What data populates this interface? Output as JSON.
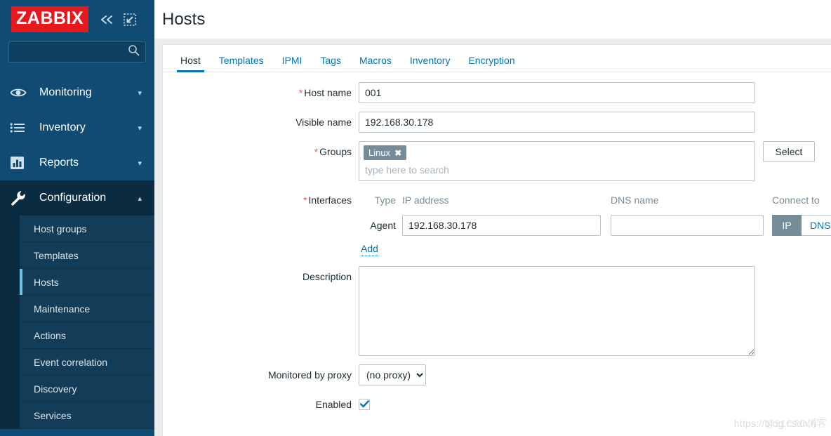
{
  "sidebar": {
    "logo_text": "ZABBIX",
    "logo_bg": "#e8191e",
    "background": "#0f4b72",
    "collapse_icon": "double-chevron-left-icon",
    "kiosk_icon": "kiosk-mode-icon",
    "search": {
      "value": "",
      "placeholder": "",
      "icon": "search-icon"
    },
    "nav": [
      {
        "label": "Monitoring",
        "icon": "eye-icon",
        "chevron": "chevron-down-icon",
        "expanded": false
      },
      {
        "label": "Inventory",
        "icon": "list-icon",
        "chevron": "chevron-down-icon",
        "expanded": false
      },
      {
        "label": "Reports",
        "icon": "bar-chart-icon",
        "chevron": "chevron-down-icon",
        "expanded": false
      },
      {
        "label": "Configuration",
        "icon": "wrench-icon",
        "chevron": "chevron-up-icon",
        "expanded": true
      }
    ],
    "submenu": [
      {
        "label": "Host groups",
        "active": false
      },
      {
        "label": "Templates",
        "active": false
      },
      {
        "label": "Hosts",
        "active": true
      },
      {
        "label": "Maintenance",
        "active": false
      },
      {
        "label": "Actions",
        "active": false
      },
      {
        "label": "Event correlation",
        "active": false
      },
      {
        "label": "Discovery",
        "active": false
      },
      {
        "label": "Services",
        "active": false
      }
    ],
    "active_indicator_color": "#6fc2ea"
  },
  "header": {
    "title": "Hosts"
  },
  "tabs": [
    {
      "label": "Host",
      "active": true
    },
    {
      "label": "Templates",
      "active": false
    },
    {
      "label": "IPMI",
      "active": false
    },
    {
      "label": "Tags",
      "active": false
    },
    {
      "label": "Macros",
      "active": false
    },
    {
      "label": "Inventory",
      "active": false
    },
    {
      "label": "Encryption",
      "active": false
    }
  ],
  "accent_color": "#0275b8",
  "required_marker": "*",
  "form": {
    "host_name": {
      "label": "Host name",
      "required": true,
      "value": "001",
      "placeholder": ""
    },
    "visible_name": {
      "label": "Visible name",
      "required": false,
      "value": "192.168.30.178",
      "placeholder": ""
    },
    "groups": {
      "label": "Groups",
      "required": true,
      "chips": [
        {
          "text": "Linux",
          "remove_icon": "close-icon"
        }
      ],
      "placeholder": "type here to search",
      "select_button": "Select"
    },
    "interfaces": {
      "label": "Interfaces",
      "required": true,
      "columns": [
        "Type",
        "IP address",
        "DNS name",
        "Connect to"
      ],
      "rows": [
        {
          "type": "Agent",
          "ip": "192.168.30.178",
          "dns": "",
          "connect_to": [
            "IP",
            "DNS"
          ],
          "connect_selected": "IP"
        }
      ],
      "add_link": "Add"
    },
    "description": {
      "label": "Description",
      "value": "",
      "placeholder": ""
    },
    "monitored_by_proxy": {
      "label": "Monitored by proxy",
      "selected": "(no proxy)",
      "options": [
        "(no proxy)"
      ]
    },
    "enabled": {
      "label": "Enabled",
      "checked": true,
      "icon": "check-icon"
    }
  },
  "watermark": {
    "line1": "https://blog.csdn.n",
    "line2": "@51CTO博客"
  }
}
